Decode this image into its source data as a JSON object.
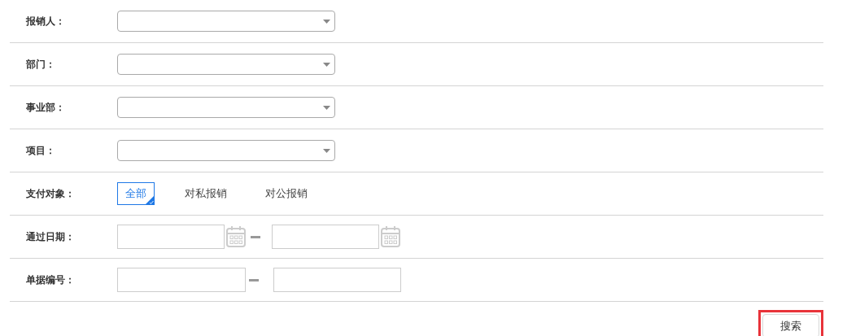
{
  "rows": [
    {
      "kind": "select",
      "label": "报销人："
    },
    {
      "kind": "select",
      "label": "部门："
    },
    {
      "kind": "select",
      "label": "事业部："
    },
    {
      "kind": "select",
      "label": "项目："
    },
    {
      "kind": "options",
      "label": "支付对象：",
      "options": [
        {
          "label": "全部",
          "selected": true
        },
        {
          "label": "对私报销",
          "selected": false
        },
        {
          "label": "对公报销",
          "selected": false
        }
      ]
    },
    {
      "kind": "daterange",
      "label": "通过日期："
    },
    {
      "kind": "range",
      "label": "单据编号："
    }
  ],
  "search_button": {
    "label": "搜索",
    "highlighted": true
  }
}
